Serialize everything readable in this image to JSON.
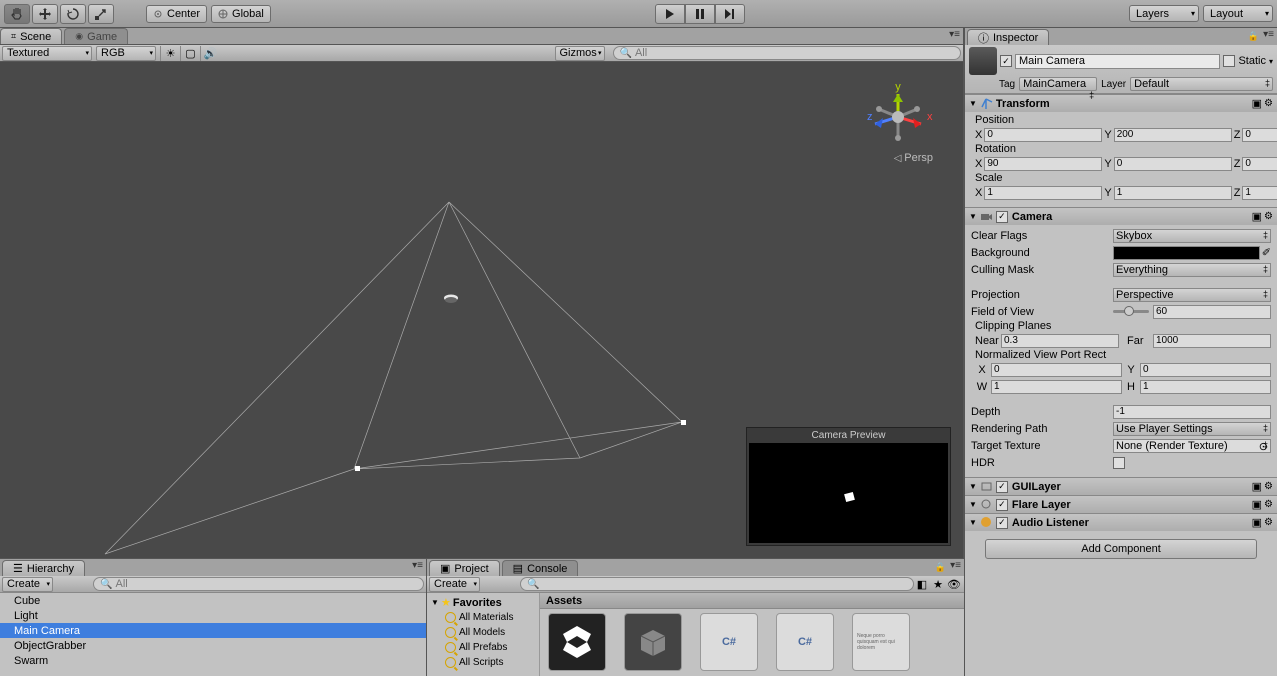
{
  "toolbar": {
    "center": "Center",
    "global": "Global",
    "layers": "Layers",
    "layout": "Layout"
  },
  "scene": {
    "tab_scene": "Scene",
    "tab_game": "Game",
    "shading": "Textured",
    "rendermode": "RGB",
    "gizmos": "Gizmos",
    "search_placeholder": "All",
    "persp": "Persp",
    "cam_preview": "Camera Preview"
  },
  "hierarchy": {
    "title": "Hierarchy",
    "create": "Create",
    "search_placeholder": "All",
    "items": [
      "Cube",
      "Light",
      "Main Camera",
      "ObjectGrabber",
      "Swarm"
    ],
    "selected": 2
  },
  "project": {
    "tab_project": "Project",
    "tab_console": "Console",
    "create": "Create",
    "favorites": "Favorites",
    "fav_items": [
      "All Materials",
      "All Models",
      "All Prefabs",
      "All Scripts"
    ],
    "assets_header": "Assets"
  },
  "inspector": {
    "title": "Inspector",
    "object_name": "Main Camera",
    "static": "Static",
    "tag_label": "Tag",
    "tag_value": "MainCamera",
    "layer_label": "Layer",
    "layer_value": "Default",
    "transform": {
      "title": "Transform",
      "position": "Position",
      "pos": {
        "x": "0",
        "y": "200",
        "z": "0"
      },
      "rotation": "Rotation",
      "rot": {
        "x": "90",
        "y": "0",
        "z": "0"
      },
      "scale": "Scale",
      "scl": {
        "x": "1",
        "y": "1",
        "z": "1"
      }
    },
    "camera": {
      "title": "Camera",
      "clear_flags_label": "Clear Flags",
      "clear_flags": "Skybox",
      "background_label": "Background",
      "culling_label": "Culling Mask",
      "culling": "Everything",
      "projection_label": "Projection",
      "projection": "Perspective",
      "fov_label": "Field of View",
      "fov": "60",
      "clip_label": "Clipping Planes",
      "near_label": "Near",
      "near": "0.3",
      "far_label": "Far",
      "far": "1000",
      "viewport_label": "Normalized View Port Rect",
      "vp": {
        "x": "0",
        "y": "0",
        "w": "1",
        "h": "1"
      },
      "depth_label": "Depth",
      "depth": "-1",
      "rendpath_label": "Rendering Path",
      "rendpath": "Use Player Settings",
      "target_label": "Target Texture",
      "target": "None (Render Texture)",
      "hdr_label": "HDR"
    },
    "guilayer": "GUILayer",
    "flare": "Flare Layer",
    "audio": "Audio Listener",
    "addcomponent": "Add Component"
  }
}
